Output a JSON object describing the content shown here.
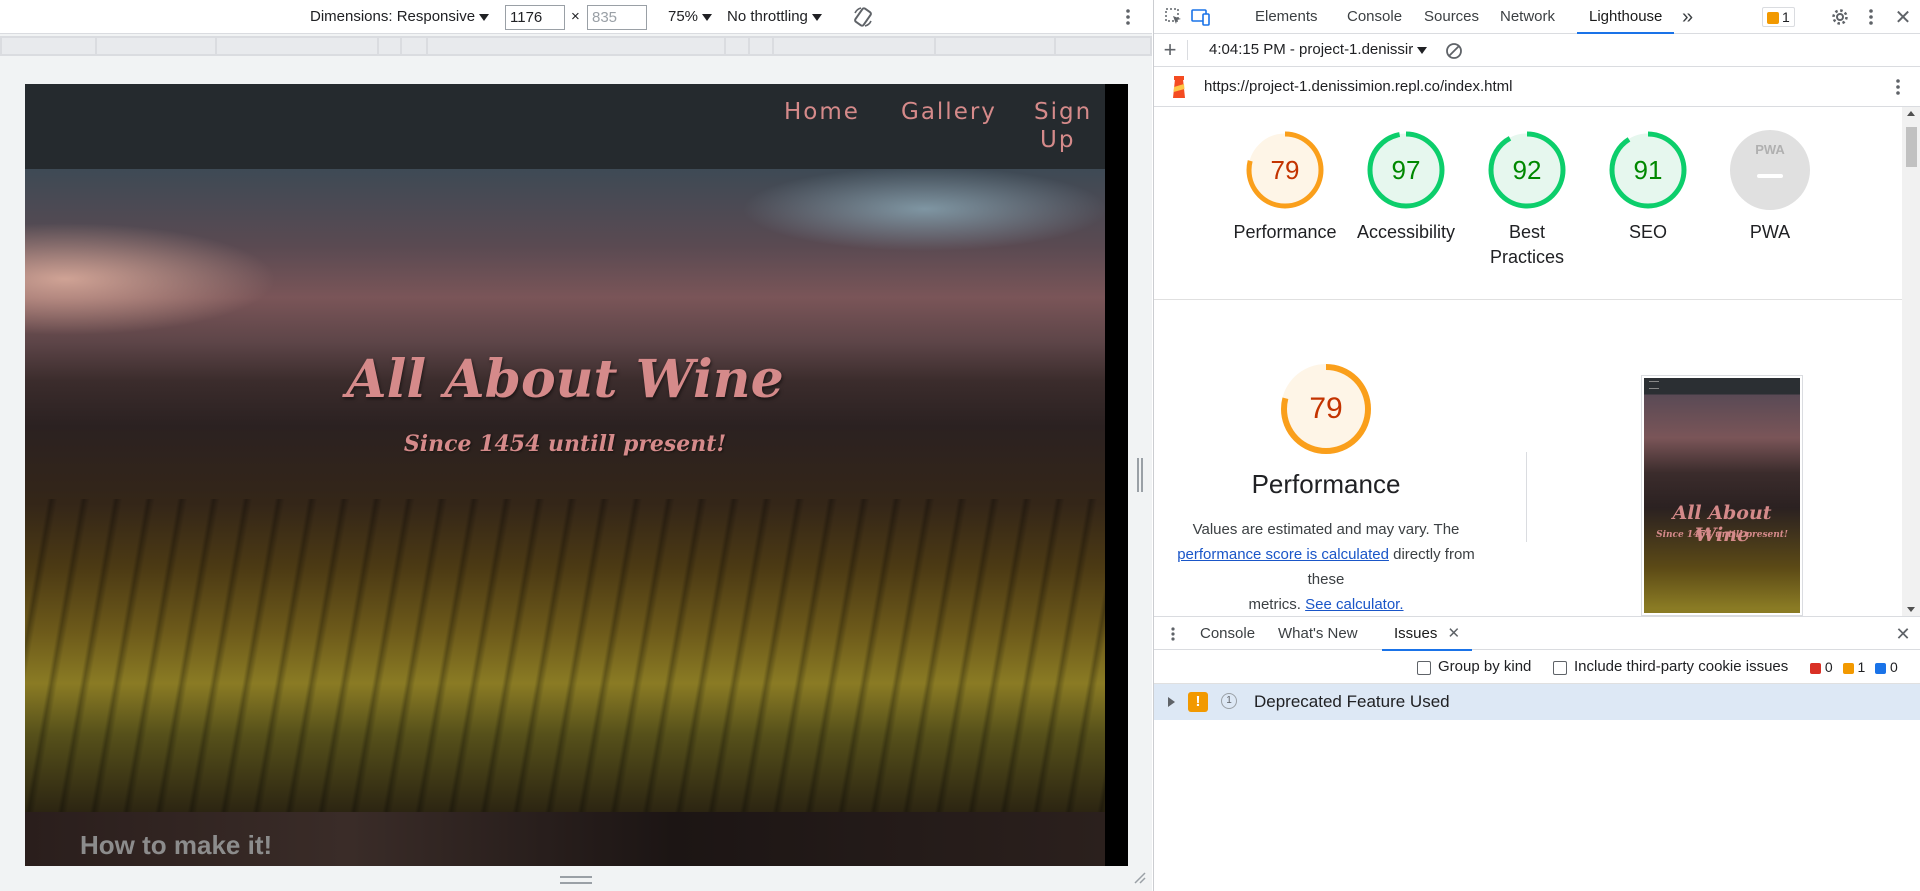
{
  "device_toolbar": {
    "dimensions_label": "Dimensions: Responsive",
    "width_value": "1176",
    "times": "×",
    "height_placeholder": "835",
    "zoom": "75%",
    "throttling": "No throttling"
  },
  "site": {
    "nav": [
      "Home",
      "Gallery",
      "Sign",
      "Up"
    ],
    "hero_title": "All About Wine",
    "hero_subtitle": "Since 1454 untill present!",
    "section_title": "How to make it!"
  },
  "devtools": {
    "tabs": [
      "Elements",
      "Console",
      "Sources",
      "Network",
      "Lighthouse"
    ],
    "more": "»",
    "issue_badge_count": "1",
    "toolbar": {
      "report_label": "4:04:15 PM - project-1.denissir"
    },
    "url": "https://project-1.denissimion.repl.co/index.html",
    "scores": [
      {
        "value": "79",
        "label": "Performance",
        "status": "average"
      },
      {
        "value": "97",
        "label": "Accessibility",
        "status": "pass"
      },
      {
        "value": "92",
        "label": "Best",
        "label2": "Practices",
        "status": "pass"
      },
      {
        "value": "91",
        "label": "SEO",
        "status": "pass"
      },
      {
        "value": "PWA",
        "label": "PWA",
        "status": "na"
      }
    ],
    "score_fractions": [
      0.79,
      0.97,
      0.92,
      0.91,
      0
    ],
    "perf": {
      "score": "79",
      "score_fraction": 0.79,
      "title": "Performance",
      "text1": "Values are estimated and may vary. The",
      "link1": "performance score is calculated",
      "text2": "directly from these",
      "text3": "metrics.",
      "link2": "See calculator."
    },
    "thumbnail": {
      "title": "All About Wine",
      "subtitle": "Since 1454 untill present!"
    },
    "drawer": {
      "tabs": [
        "Console",
        "What's New",
        "Issues"
      ],
      "group_by_kind": "Group by kind",
      "third_party": "Include third-party cookie issues",
      "counts": [
        "0",
        "1",
        "0"
      ],
      "issue_title": "Deprecated Feature Used",
      "issue_count": "1"
    },
    "colors": {
      "average": "#fa9f1b",
      "pass": "#0cce6b",
      "average_text": "#c33300",
      "pass_text": "#008800",
      "accent": "#1a73e8"
    }
  }
}
